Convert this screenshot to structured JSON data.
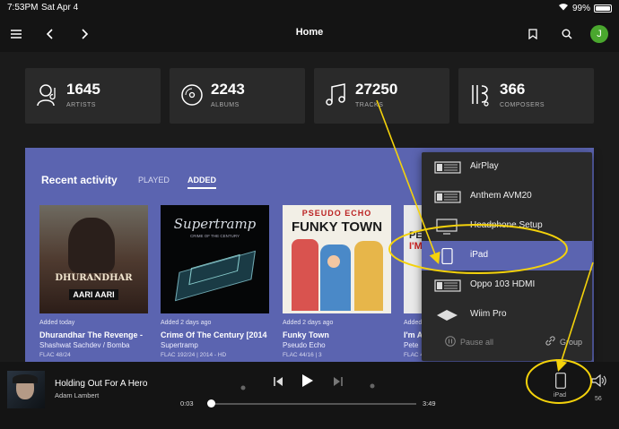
{
  "status": {
    "time": "7:53PM",
    "date": "Sat Apr 4",
    "battery": "99%"
  },
  "nav": {
    "title": "Home",
    "avatar_initial": "J"
  },
  "stats": [
    {
      "value": "1645",
      "label": "ARTISTS",
      "icon": "artist-icon"
    },
    {
      "value": "2243",
      "label": "ALBUMS",
      "icon": "album-icon"
    },
    {
      "value": "27250",
      "label": "TRACKS",
      "icon": "tracks-icon"
    },
    {
      "value": "366",
      "label": "COMPOSERS",
      "icon": "composer-icon"
    }
  ],
  "recent": {
    "title": "Recent activity",
    "tabs": [
      "PLAYED",
      "ADDED"
    ],
    "active_tab": "ADDED",
    "albums": [
      {
        "added": "Added today",
        "name": "Dhurandhar The Revenge -",
        "artist": "Shashwat Sachdev / Bomba",
        "format": "FLAC 48/24",
        "art_text_1": "DHURANDHAR",
        "art_text_2": "AARI AARI"
      },
      {
        "added": "Added 2 days ago",
        "name": "Crime Of The Century [2014",
        "artist": "Supertramp",
        "format": "FLAC 192/24 | 2014 - HD",
        "art_text_1": "Supertramp",
        "art_text_2": "CRIME OF THE CENTURY"
      },
      {
        "added": "Added 2 days ago",
        "name": "Funky Town",
        "artist": "Pseudo Echo",
        "format": "FLAC 44/16 | 3",
        "art_text_1": "PSEUDO ECHO",
        "art_text_2": "FUNKY TOWN"
      },
      {
        "added": "Added",
        "name": "I'm A",
        "artist": "Pete",
        "format": "FLAC 44/16 | 13",
        "art_text_1": "PE",
        "art_text_2": "I'M"
      }
    ]
  },
  "zones": {
    "items": [
      "AirPlay",
      "Anthem AVM20",
      "Headphone Setup",
      "iPad",
      "Oppo 103 HDMI",
      "Wiim Pro"
    ],
    "selected": "iPad",
    "pause_all": "Pause all",
    "group": "Group"
  },
  "player": {
    "track": "Holding Out For A Hero",
    "artist": "Adam Lambert",
    "elapsed": "0:03",
    "duration": "3:49",
    "progress": 0.013,
    "zone_label": "iPad",
    "volume": "56"
  },
  "colors": {
    "accent": "#5b64b0",
    "annotation": "#f4d20b",
    "background": "#1b1b1b"
  }
}
